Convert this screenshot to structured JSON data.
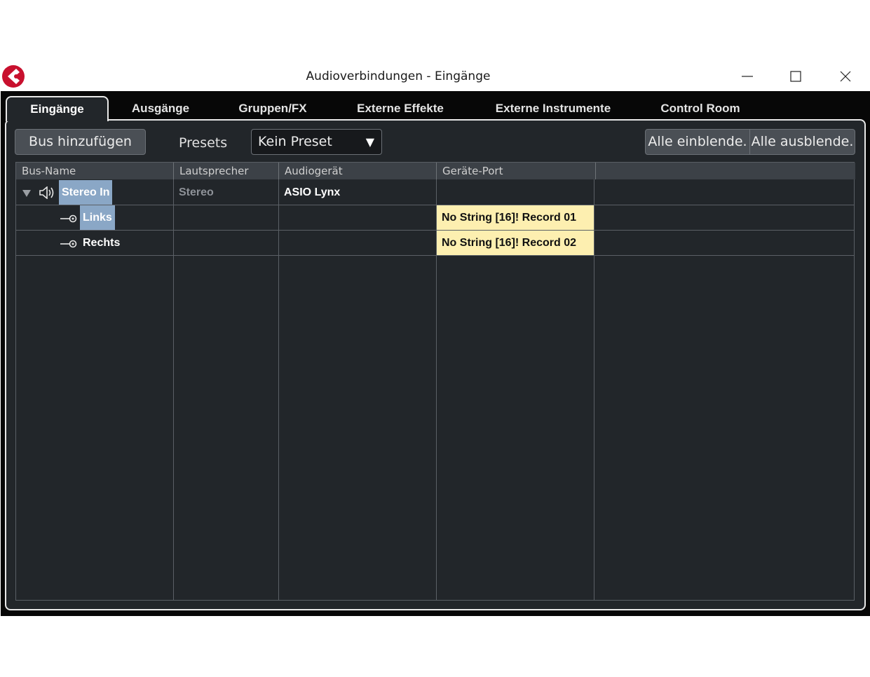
{
  "window": {
    "title": "Audioverbindungen - Eingänge"
  },
  "tabs": [
    "Eingänge",
    "Ausgänge",
    "Gruppen/FX",
    "Externe Effekte",
    "Externe Instrumente",
    "Control Room"
  ],
  "toolbar": {
    "add_bus_label": "Bus hinzufügen",
    "presets_label": "Presets",
    "preset_value": "Kein Preset",
    "show_all_label": "Alle einblende.",
    "hide_all_label": "Alle ausblende."
  },
  "table": {
    "columns": [
      "Bus-Name",
      "Lautsprecher",
      "Audiogerät",
      "Geräte-Port",
      ""
    ],
    "rows": [
      {
        "name": "Stereo In",
        "speaker": "Stereo",
        "device": "ASIO Lynx",
        "port": ""
      },
      {
        "name": "Links",
        "speaker": "",
        "device": "",
        "port": "No String [16]! Record 01"
      },
      {
        "name": "Rechts",
        "speaker": "",
        "device": "",
        "port": "No String [16]! Record 02"
      }
    ]
  },
  "colors": {
    "accent": "#c8102e",
    "selection": "#8aa7c6",
    "port_highlight": "#fdefb0",
    "background": "#22262a"
  }
}
